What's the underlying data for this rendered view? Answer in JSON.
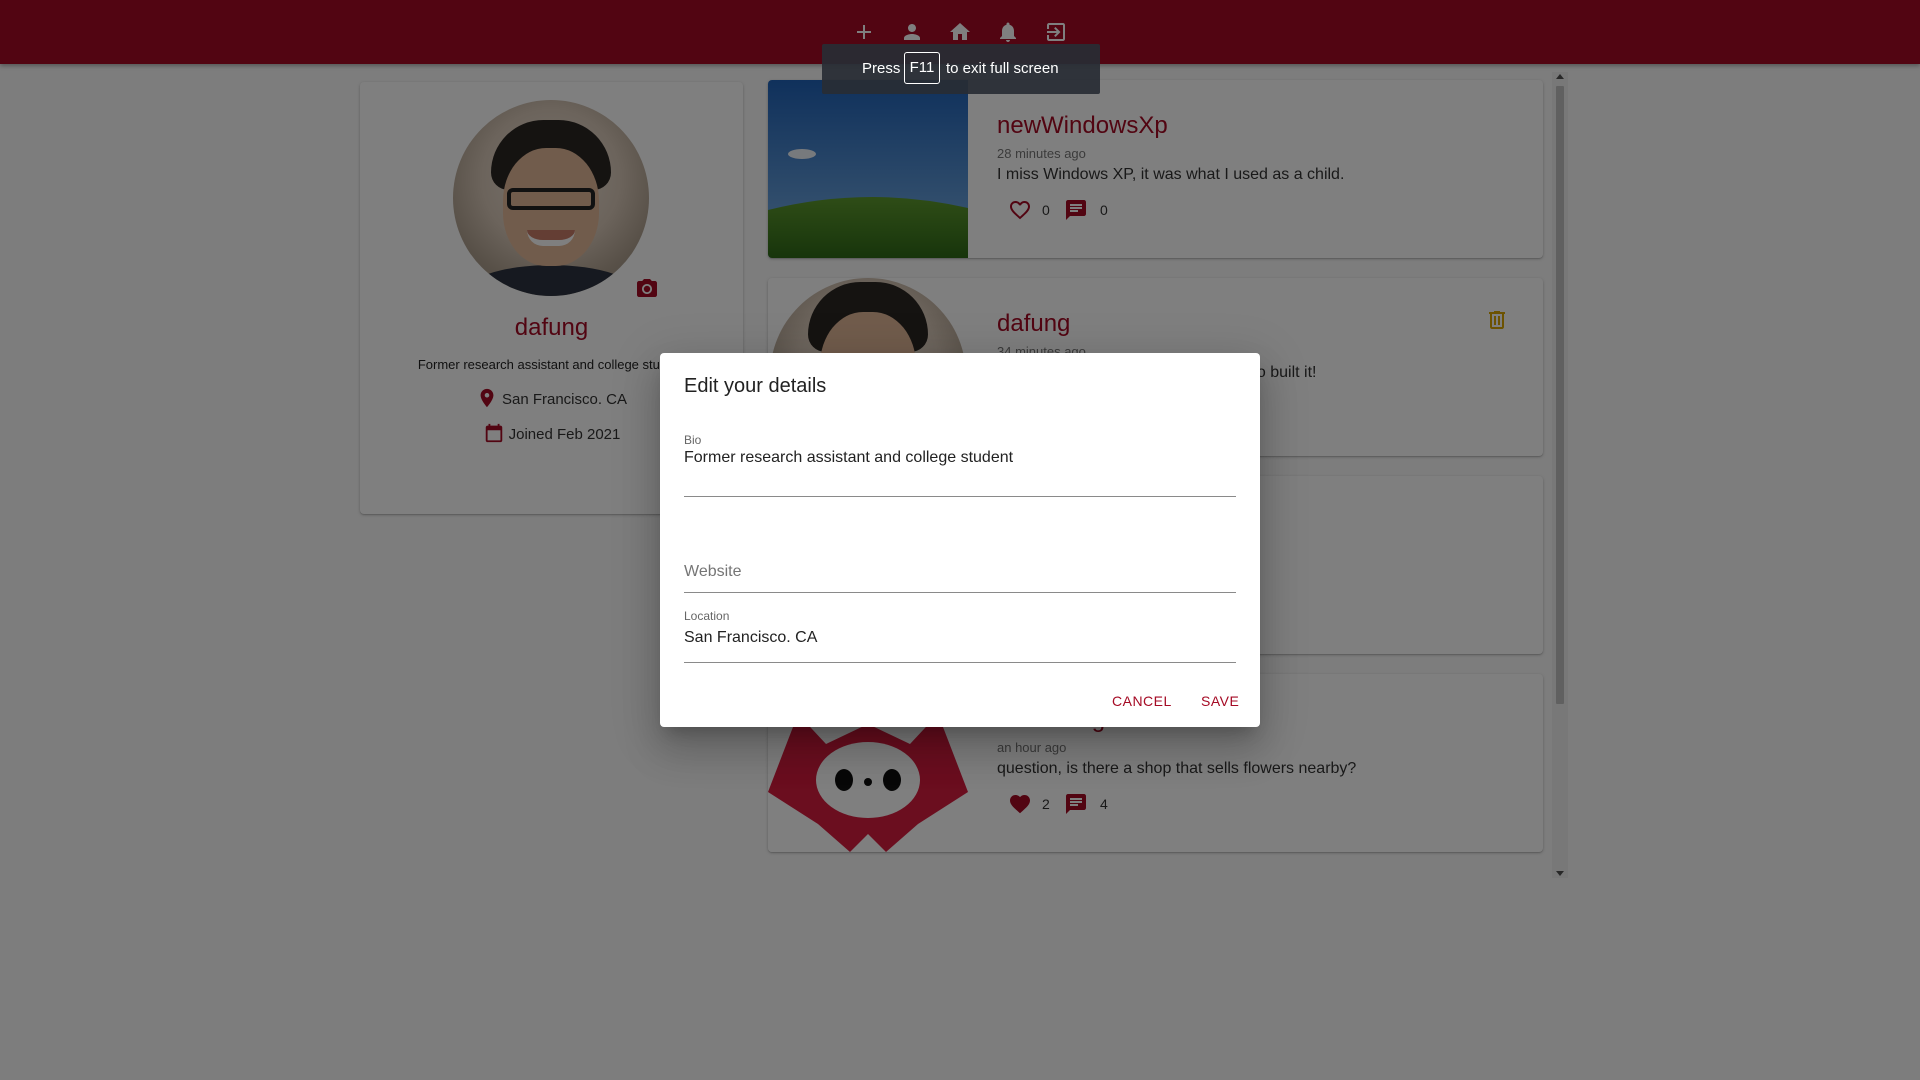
{
  "colors": {
    "primary": "#a50a24",
    "background": "#fafafa"
  },
  "nav": {
    "icons": [
      "add-icon",
      "person-icon",
      "home-icon",
      "notifications-icon",
      "logout-icon"
    ]
  },
  "fullscreen_toast": {
    "before": "Press",
    "key": "F11",
    "after": "to exit full screen"
  },
  "profile": {
    "handle": "dafung",
    "bio": "Former research assistant and college student",
    "location": "San Francisco. CA",
    "joined": "Joined Feb 2021"
  },
  "posts": [
    {
      "user": "newWindowsXp",
      "time": "28 minutes ago",
      "body": "I miss Windows XP, it was what I used as a child.",
      "likes": "0",
      "comments": "0"
    },
    {
      "user": "dafung",
      "time": "34 minutes ago",
      "body": "ho built it!",
      "likes": "",
      "comments": ""
    },
    {
      "user": "",
      "time": "",
      "body": "",
      "likes": "",
      "comments": ""
    },
    {
      "user": "blackDragon2",
      "time": "an hour ago",
      "body": "question, is there a shop that sells flowers nearby?",
      "likes": "2",
      "comments": "4"
    }
  ],
  "dialog": {
    "title": "Edit your details",
    "bio_label": "Bio",
    "bio_value": "Former research assistant and college student",
    "website_placeholder": "Website",
    "website_value": "",
    "location_label": "Location",
    "location_value": "San Francisco. CA",
    "cancel_label": "CANCEL",
    "save_label": "SAVE"
  }
}
